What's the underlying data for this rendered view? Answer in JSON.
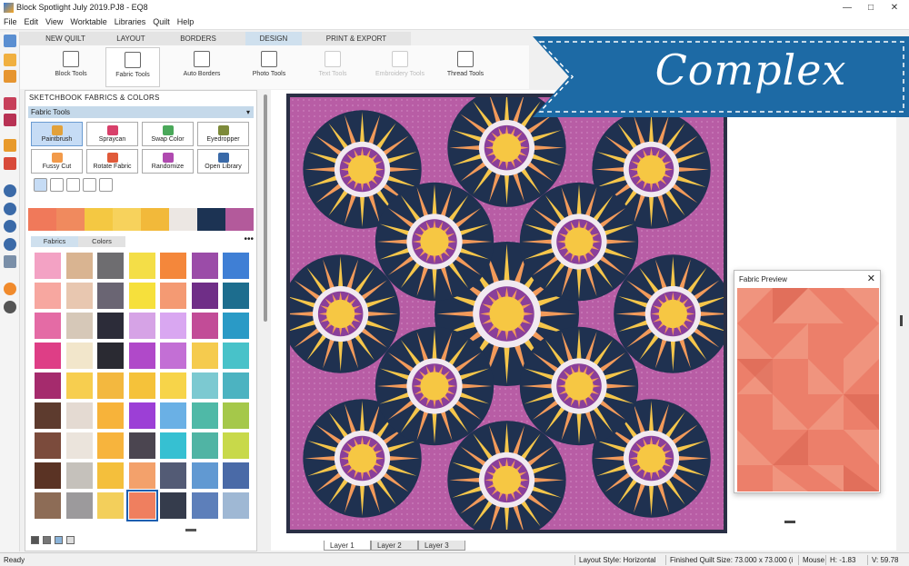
{
  "window": {
    "title": "Block Spotlight July 2019.PJ8 - EQ8"
  },
  "menu": [
    "File",
    "Edit",
    "View",
    "Worktable",
    "Libraries",
    "Quilt",
    "Help"
  ],
  "tabs": [
    {
      "label": "NEW QUILT"
    },
    {
      "label": "LAYOUT"
    },
    {
      "label": "BORDERS"
    },
    {
      "label": "DESIGN"
    },
    {
      "label": "PRINT & EXPORT"
    }
  ],
  "ribbon": [
    {
      "label": "Block Tools"
    },
    {
      "label": "Fabric Tools"
    },
    {
      "label": "Auto Borders"
    },
    {
      "label": "Photo Tools"
    },
    {
      "label": "Text Tools"
    },
    {
      "label": "Embroidery Tools"
    },
    {
      "label": "Thread Tools"
    }
  ],
  "sketchbook": {
    "title": "SKETCHBOOK FABRICS & COLORS",
    "section": "Fabric Tools",
    "tools": [
      {
        "label": "Paintbrush"
      },
      {
        "label": "Spraycan"
      },
      {
        "label": "Swap Color"
      },
      {
        "label": "Eyedropper"
      },
      {
        "label": "Fussy Cut"
      },
      {
        "label": "Rotate Fabric"
      },
      {
        "label": "Randomize"
      },
      {
        "label": "Open Library"
      }
    ],
    "subtabs": [
      {
        "label": "Fabrics"
      },
      {
        "label": "Colors"
      }
    ],
    "more": "•••"
  },
  "colors": {
    "recent": [
      "#f0795a",
      "#f08a5e",
      "#f4c842",
      "#f7d25c",
      "#f2b93a",
      "#ece7e3",
      "#1c3353",
      "#b35a9b"
    ],
    "swatches": [
      "#f3a2c4",
      "#d9b491",
      "#6e6d70",
      "#f4de47",
      "#f4873b",
      "#9b4ca8",
      "#3f7fd5",
      "#f7a7a0",
      "#e8c7b0",
      "#6a6573",
      "#f6e03c",
      "#f49a73",
      "#6f2e87",
      "#1d6d8e",
      "#e46ba5",
      "#d6c8b8",
      "#2c2c39",
      "#d6a3e6",
      "#d9a7f1",
      "#c24c97",
      "#2a9ac6",
      "#de3e86",
      "#f2e6cb",
      "#2a2a32",
      "#b049c9",
      "#c36fd5",
      "#f5cb4e",
      "#48c2c9",
      "#a52b6d",
      "#f7ce4f",
      "#f3b83f",
      "#f5c23a",
      "#f7d449",
      "#7cc9d1",
      "#4cb3c1",
      "#5d3b2e",
      "#e4dad2",
      "#f7b33a",
      "#9c3fd6",
      "#6ab0e5",
      "#4fb9a7",
      "#a5c84a",
      "#7b4b3c",
      "#ebe4dc",
      "#f7b43d",
      "#4b4550",
      "#36c0d2",
      "#50b4a4",
      "#c8d94a",
      "#5a3324",
      "#c5c1bb",
      "#f4bf3c",
      "#f3a16b",
      "#535b75",
      "#6199d2",
      "#4a6aa7",
      "#8d6c56",
      "#9c9a9c",
      "#f3cf5b",
      "#ef7f5f",
      "#353c4c",
      "#5d7fba",
      "#9fb8d4"
    ],
    "banner": "#1d6aa5",
    "accent": "#1d5fb0"
  },
  "layers": [
    {
      "label": "Layer 1"
    },
    {
      "label": "Layer 2"
    },
    {
      "label": "Layer 3"
    }
  ],
  "preview": {
    "title": "Fabric Preview",
    "close": "✕"
  },
  "status": {
    "left": "Ready",
    "layout": "Layout Style: Horizontal",
    "size": "Finished Quilt Size: 73.000 x 73.000 (i",
    "mouse": "Mouse",
    "h": "H:  -1.83",
    "v": "V:  59.78"
  },
  "banner": {
    "text": "Complex"
  }
}
